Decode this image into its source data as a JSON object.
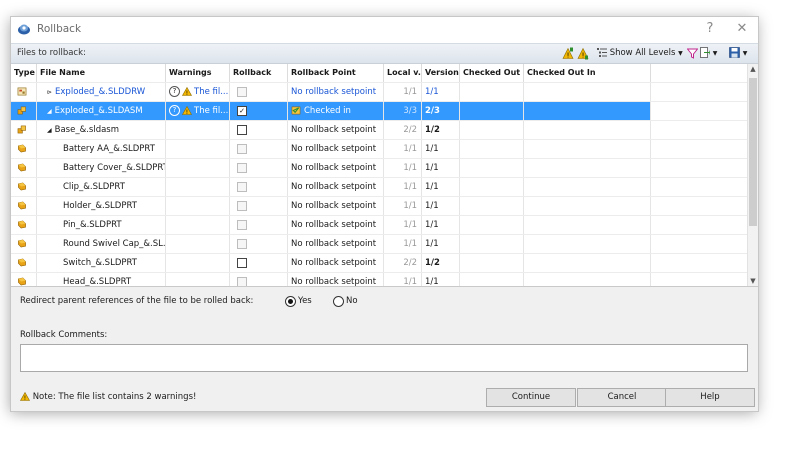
{
  "window": {
    "title": "Rollback",
    "help_glyph": "?",
    "close_glyph": "✕"
  },
  "toolbar": {
    "files_label": "Files to rollback:",
    "show_levels": "Show All Levels",
    "icons": [
      "warning-up-icon",
      "warning-down-icon",
      "levels-icon",
      "filter-icon",
      "export-icon",
      "save-icon"
    ]
  },
  "columns": [
    "Type",
    "File Name",
    "Warnings",
    "Rollback",
    "Rollback Point",
    "Local v...",
    "Version",
    "Checked Out ...",
    "Checked Out In"
  ],
  "rows": [
    {
      "type": "drawing",
      "name": "Exploded_&.SLDDRW",
      "prefix": "⊳",
      "warning": "The fil...",
      "rollback": "disabled",
      "point": "No rollback setpoint",
      "point_link": true,
      "local": "1/1",
      "version": "1/1",
      "version_link": true,
      "selected": false
    },
    {
      "type": "assembly",
      "name": "Exploded_&.SLDASM",
      "prefix": "◢",
      "warning": "The fil...",
      "rollback": "checked",
      "point": "Checked in",
      "point_link": false,
      "local": "3/3",
      "version": "2/3",
      "version_bold": true,
      "selected": true
    },
    {
      "type": "assembly",
      "name": "Base_&.sldasm",
      "prefix": "◢",
      "warning": "",
      "rollback": "enabled",
      "point": "No rollback setpoint",
      "local": "2/2",
      "version": "1/2",
      "version_bold": true,
      "selected": false
    },
    {
      "type": "part",
      "name": "Battery AA_&.SLDPRT",
      "prefix": "",
      "warning": "",
      "rollback": "disabled",
      "point": "No rollback setpoint",
      "local": "1/1",
      "version": "1/1",
      "selected": false
    },
    {
      "type": "part",
      "name": "Battery Cover_&.SLDPRT",
      "prefix": "",
      "warning": "",
      "rollback": "disabled",
      "point": "No rollback setpoint",
      "local": "1/1",
      "version": "1/1",
      "selected": false
    },
    {
      "type": "part",
      "name": "Clip_&.SLDPRT",
      "prefix": "",
      "warning": "",
      "rollback": "disabled",
      "point": "No rollback setpoint",
      "local": "1/1",
      "version": "1/1",
      "selected": false
    },
    {
      "type": "part",
      "name": "Holder_&.SLDPRT",
      "prefix": "",
      "warning": "",
      "rollback": "disabled",
      "point": "No rollback setpoint",
      "local": "1/1",
      "version": "1/1",
      "selected": false
    },
    {
      "type": "part",
      "name": "Pin_&.SLDPRT",
      "prefix": "",
      "warning": "",
      "rollback": "disabled",
      "point": "No rollback setpoint",
      "local": "1/1",
      "version": "1/1",
      "selected": false
    },
    {
      "type": "part",
      "name": "Round Swivel Cap_&.SL...",
      "prefix": "",
      "warning": "",
      "rollback": "disabled",
      "point": "No rollback setpoint",
      "local": "1/1",
      "version": "1/1",
      "selected": false
    },
    {
      "type": "part",
      "name": "Switch_&.SLDPRT",
      "prefix": "",
      "warning": "",
      "rollback": "enabled",
      "point": "No rollback setpoint",
      "local": "2/2",
      "version": "1/2",
      "version_bold": true,
      "selected": false
    },
    {
      "type": "part",
      "name": "Head_&.SLDPRT",
      "prefix": "",
      "warning": "",
      "rollback": "disabled",
      "point": "No rollback setpoint",
      "local": "1/1",
      "version": "1/1",
      "selected": false
    }
  ],
  "redirect": {
    "label": "Redirect parent references of the file to be rolled back:",
    "yes": "Yes",
    "no": "No",
    "selected": "Yes"
  },
  "comments": {
    "label": "Rollback Comments:",
    "value": ""
  },
  "footer": {
    "note": "Note: The file list contains 2 warnings!"
  },
  "buttons": {
    "continue": "Continue",
    "cancel": "Cancel",
    "help": "Help"
  },
  "colors": {
    "selection": "#3399ff",
    "link": "#1a56d6",
    "warning": "#f2b705",
    "part": "#e8a317"
  }
}
